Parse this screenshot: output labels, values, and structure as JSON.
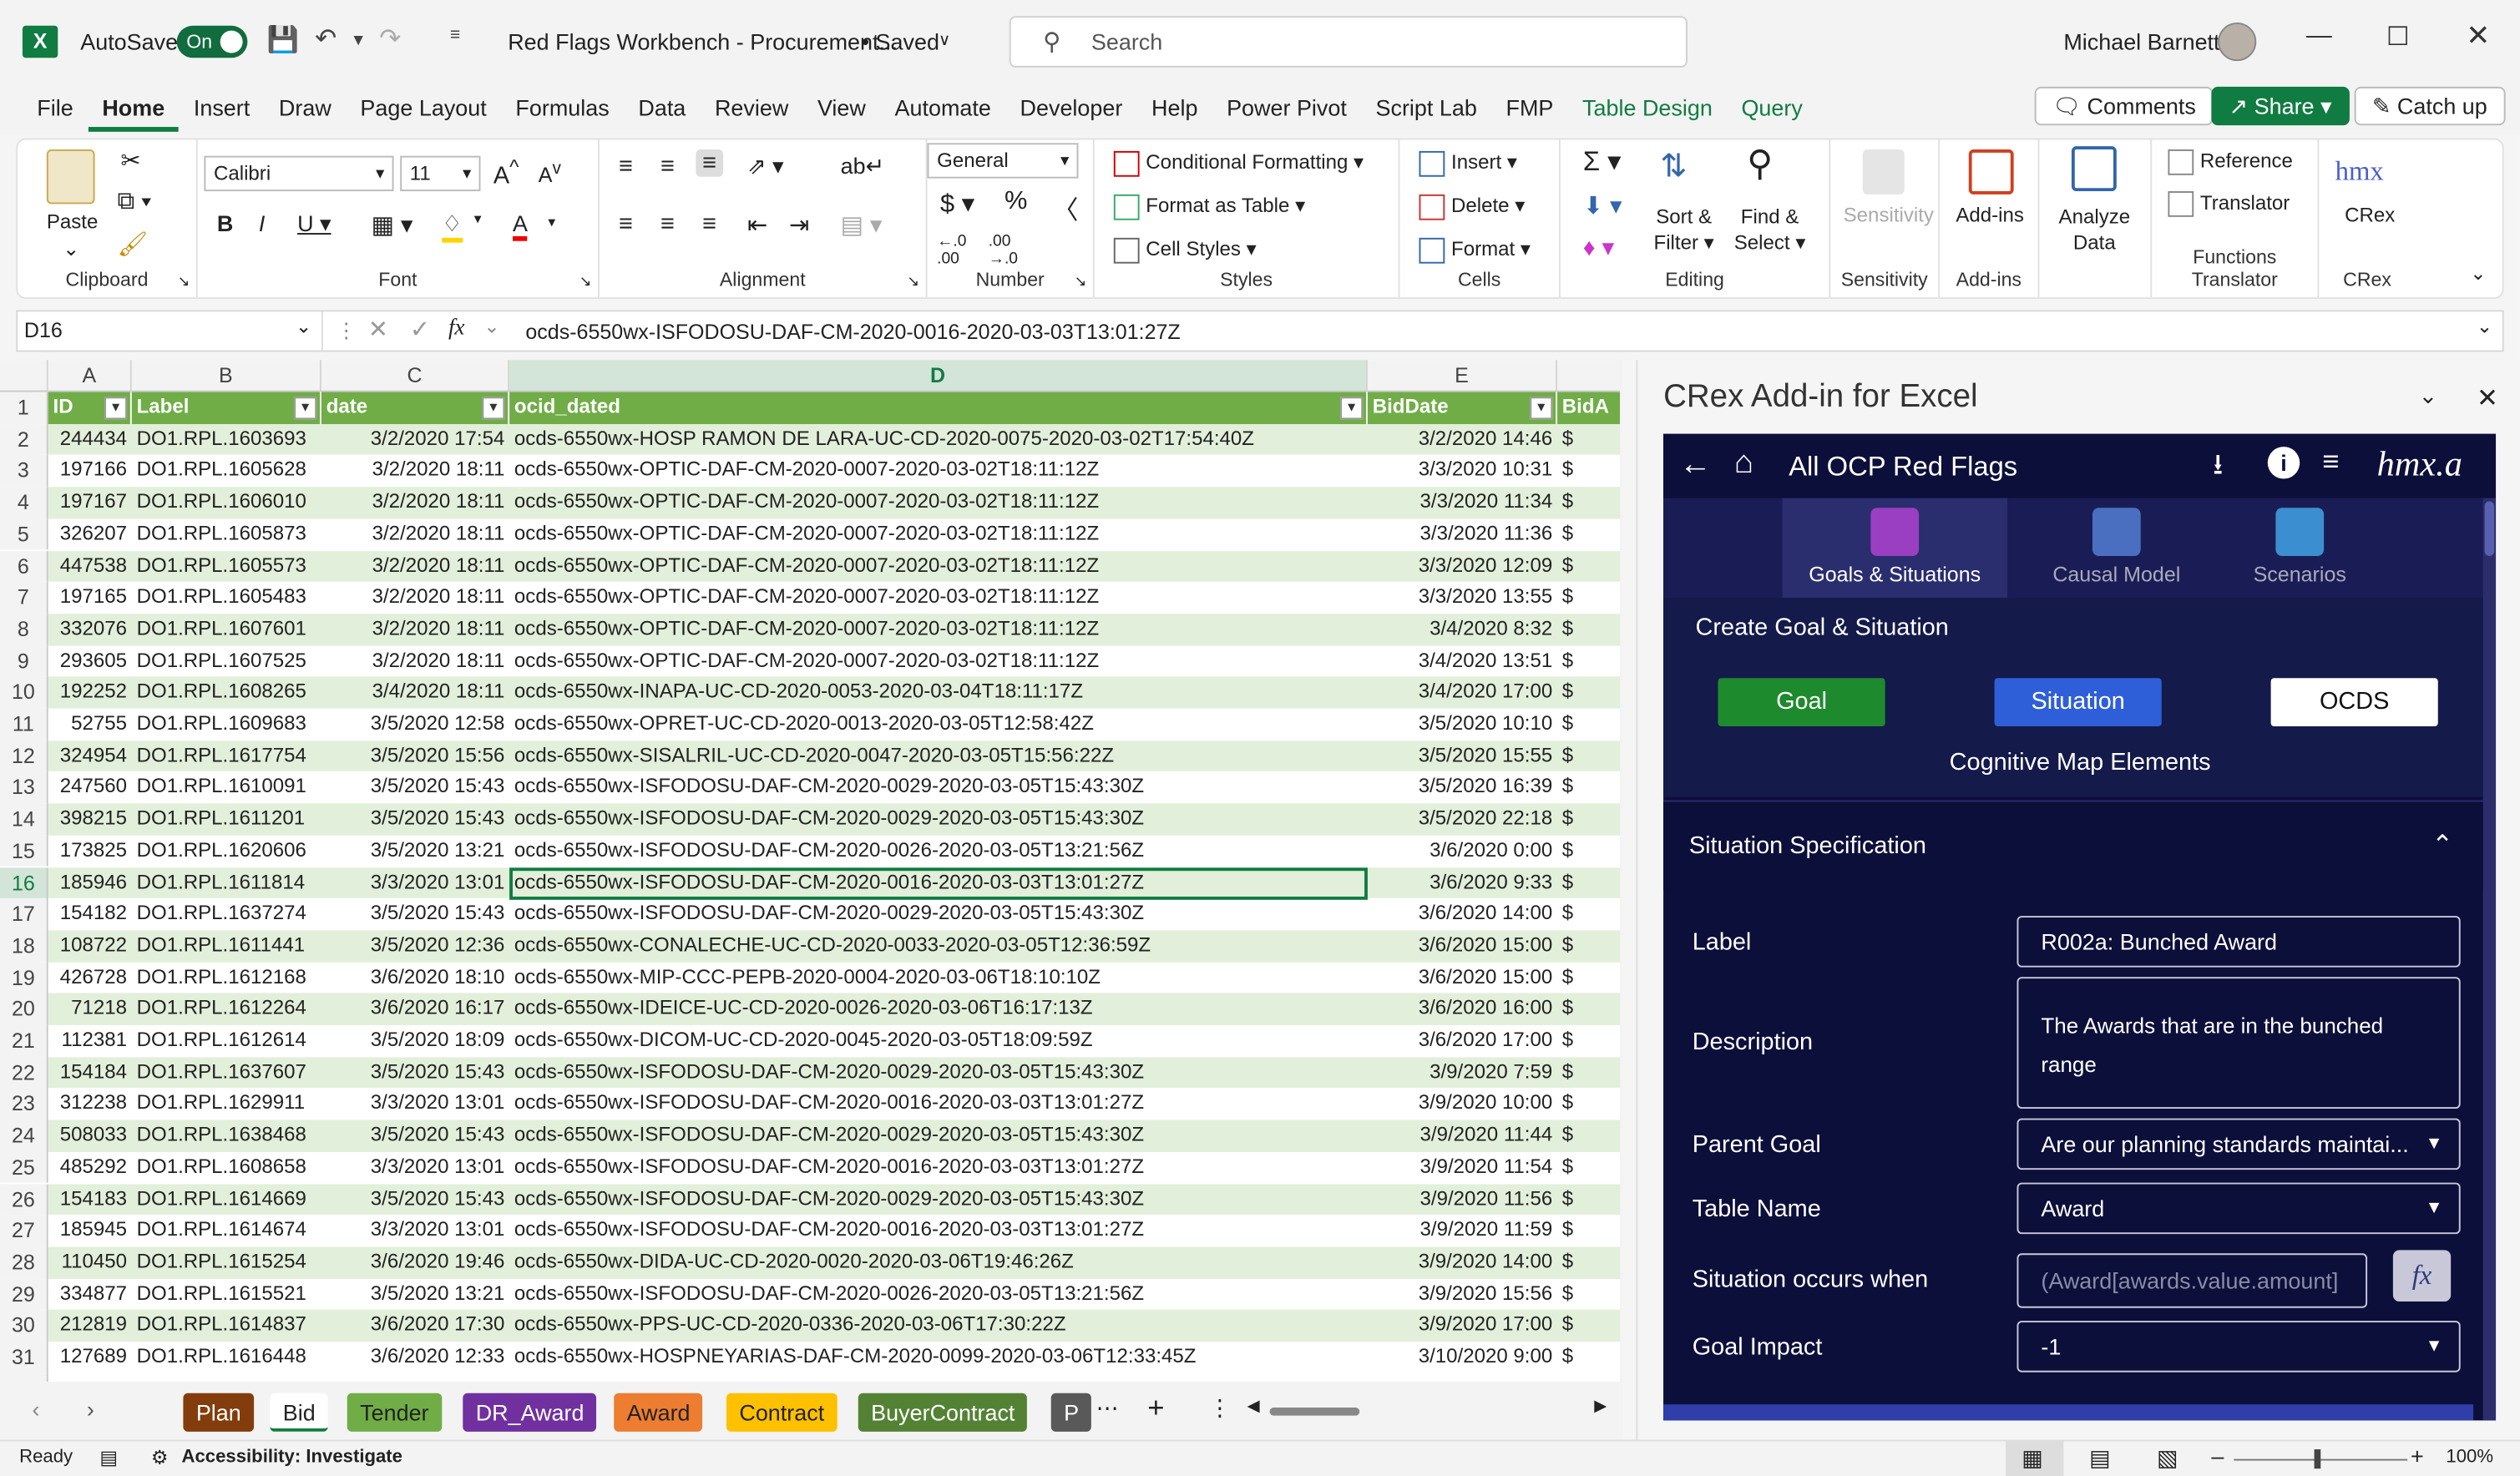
{
  "window": {
    "autosave": "AutoSave",
    "toggle": "On",
    "title": "Red Flags Workbench - Procurement...",
    "saved": "• Saved",
    "search": "Search",
    "user": "Michael Barnett"
  },
  "menu": [
    "File",
    "Home",
    "Insert",
    "Draw",
    "Page Layout",
    "Formulas",
    "Data",
    "Review",
    "View",
    "Automate",
    "Developer",
    "Help",
    "Power Pivot",
    "Script Lab",
    "FMP",
    "Table Design",
    "Query"
  ],
  "top_buttons": {
    "comments": "Comments",
    "share": "Share",
    "catchup": "Catch up"
  },
  "ribbon": {
    "clipboard": {
      "label": "Clipboard",
      "paste": "Paste"
    },
    "font": {
      "label": "Font",
      "name": "Calibri",
      "size": "11"
    },
    "alignment": {
      "label": "Alignment"
    },
    "number": {
      "label": "Number",
      "format": "General"
    },
    "styles": {
      "label": "Styles",
      "cond": "Conditional Formatting",
      "table": "Format as Table",
      "cell": "Cell Styles"
    },
    "cells": {
      "label": "Cells",
      "insert": "Insert",
      "delete": "Delete",
      "format": "Format"
    },
    "editing": {
      "label": "Editing",
      "sort1": "Sort &",
      "sort2": "Filter",
      "find1": "Find &",
      "find2": "Select"
    },
    "sensitivity": {
      "label": "Sensitivity",
      "btn": "Sensitivity"
    },
    "addins": {
      "label": "Add-ins",
      "btn": "Add-ins"
    },
    "analyze": {
      "btn1": "Analyze",
      "btn2": "Data"
    },
    "functrans": {
      "label": "Functions Translator",
      "ref": "Reference",
      "trans": "Translator"
    },
    "crex": {
      "label": "CRex",
      "btn": "CRex",
      "logo": "hmx"
    }
  },
  "formula": {
    "namebox": "D16",
    "fx": "fx",
    "content": "ocds-6550wx-ISFODOSU-DAF-CM-2020-0016-2020-03-03T13:01:27Z"
  },
  "columns": [
    "A",
    "B",
    "C",
    "D",
    "E"
  ],
  "headers": [
    "ID",
    "Label",
    "date",
    "ocid_dated",
    "BidDate",
    "BidA"
  ],
  "rows": [
    [
      "244434",
      "DO1.RPL.1603693",
      "3/2/2020 17:54",
      "ocds-6550wx-HOSP RAMON DE LARA-UC-CD-2020-0075-2020-03-02T17:54:40Z",
      "3/2/2020 14:46"
    ],
    [
      "197166",
      "DO1.RPL.1605628",
      "3/2/2020 18:11",
      "ocds-6550wx-OPTIC-DAF-CM-2020-0007-2020-03-02T18:11:12Z",
      "3/3/2020 10:31"
    ],
    [
      "197167",
      "DO1.RPL.1606010",
      "3/2/2020 18:11",
      "ocds-6550wx-OPTIC-DAF-CM-2020-0007-2020-03-02T18:11:12Z",
      "3/3/2020 11:34"
    ],
    [
      "326207",
      "DO1.RPL.1605873",
      "3/2/2020 18:11",
      "ocds-6550wx-OPTIC-DAF-CM-2020-0007-2020-03-02T18:11:12Z",
      "3/3/2020 11:36"
    ],
    [
      "447538",
      "DO1.RPL.1605573",
      "3/2/2020 18:11",
      "ocds-6550wx-OPTIC-DAF-CM-2020-0007-2020-03-02T18:11:12Z",
      "3/3/2020 12:09"
    ],
    [
      "197165",
      "DO1.RPL.1605483",
      "3/2/2020 18:11",
      "ocds-6550wx-OPTIC-DAF-CM-2020-0007-2020-03-02T18:11:12Z",
      "3/3/2020 13:55"
    ],
    [
      "332076",
      "DO1.RPL.1607601",
      "3/2/2020 18:11",
      "ocds-6550wx-OPTIC-DAF-CM-2020-0007-2020-03-02T18:11:12Z",
      "3/4/2020 8:32"
    ],
    [
      "293605",
      "DO1.RPL.1607525",
      "3/2/2020 18:11",
      "ocds-6550wx-OPTIC-DAF-CM-2020-0007-2020-03-02T18:11:12Z",
      "3/4/2020 13:51"
    ],
    [
      "192252",
      "DO1.RPL.1608265",
      "3/4/2020 18:11",
      "ocds-6550wx-INAPA-UC-CD-2020-0053-2020-03-04T18:11:17Z",
      "3/4/2020 17:00"
    ],
    [
      "52755",
      "DO1.RPL.1609683",
      "3/5/2020 12:58",
      "ocds-6550wx-OPRET-UC-CD-2020-0013-2020-03-05T12:58:42Z",
      "3/5/2020 10:10"
    ],
    [
      "324954",
      "DO1.RPL.1617754",
      "3/5/2020 15:56",
      "ocds-6550wx-SISALRIL-UC-CD-2020-0047-2020-03-05T15:56:22Z",
      "3/5/2020 15:55"
    ],
    [
      "247560",
      "DO1.RPL.1610091",
      "3/5/2020 15:43",
      "ocds-6550wx-ISFODOSU-DAF-CM-2020-0029-2020-03-05T15:43:30Z",
      "3/5/2020 16:39"
    ],
    [
      "398215",
      "DO1.RPL.1611201",
      "3/5/2020 15:43",
      "ocds-6550wx-ISFODOSU-DAF-CM-2020-0029-2020-03-05T15:43:30Z",
      "3/5/2020 22:18"
    ],
    [
      "173825",
      "DO1.RPL.1620606",
      "3/5/2020 13:21",
      "ocds-6550wx-ISFODOSU-DAF-CM-2020-0026-2020-03-05T13:21:56Z",
      "3/6/2020 0:00"
    ],
    [
      "185946",
      "DO1.RPL.1611814",
      "3/3/2020 13:01",
      "ocds-6550wx-ISFODOSU-DAF-CM-2020-0016-2020-03-03T13:01:27Z",
      "3/6/2020 9:33"
    ],
    [
      "154182",
      "DO1.RPL.1637274",
      "3/5/2020 15:43",
      "ocds-6550wx-ISFODOSU-DAF-CM-2020-0029-2020-03-05T15:43:30Z",
      "3/6/2020 14:00"
    ],
    [
      "108722",
      "DO1.RPL.1611441",
      "3/5/2020 12:36",
      "ocds-6550wx-CONALECHE-UC-CD-2020-0033-2020-03-05T12:36:59Z",
      "3/6/2020 15:00"
    ],
    [
      "426728",
      "DO1.RPL.1612168",
      "3/6/2020 18:10",
      "ocds-6550wx-MIP-CCC-PEPB-2020-0004-2020-03-06T18:10:10Z",
      "3/6/2020 15:00"
    ],
    [
      "71218",
      "DO1.RPL.1612264",
      "3/6/2020 16:17",
      "ocds-6550wx-IDEICE-UC-CD-2020-0026-2020-03-06T16:17:13Z",
      "3/6/2020 16:00"
    ],
    [
      "112381",
      "DO1.RPL.1612614",
      "3/5/2020 18:09",
      "ocds-6550wx-DICOM-UC-CD-2020-0045-2020-03-05T18:09:59Z",
      "3/6/2020 17:00"
    ],
    [
      "154184",
      "DO1.RPL.1637607",
      "3/5/2020 15:43",
      "ocds-6550wx-ISFODOSU-DAF-CM-2020-0029-2020-03-05T15:43:30Z",
      "3/9/2020 7:59"
    ],
    [
      "312238",
      "DO1.RPL.1629911",
      "3/3/2020 13:01",
      "ocds-6550wx-ISFODOSU-DAF-CM-2020-0016-2020-03-03T13:01:27Z",
      "3/9/2020 10:00"
    ],
    [
      "508033",
      "DO1.RPL.1638468",
      "3/5/2020 15:43",
      "ocds-6550wx-ISFODOSU-DAF-CM-2020-0029-2020-03-05T15:43:30Z",
      "3/9/2020 11:44"
    ],
    [
      "485292",
      "DO1.RPL.1608658",
      "3/3/2020 13:01",
      "ocds-6550wx-ISFODOSU-DAF-CM-2020-0016-2020-03-03T13:01:27Z",
      "3/9/2020 11:54"
    ],
    [
      "154183",
      "DO1.RPL.1614669",
      "3/5/2020 15:43",
      "ocds-6550wx-ISFODOSU-DAF-CM-2020-0029-2020-03-05T15:43:30Z",
      "3/9/2020 11:56"
    ],
    [
      "185945",
      "DO1.RPL.1614674",
      "3/3/2020 13:01",
      "ocds-6550wx-ISFODOSU-DAF-CM-2020-0016-2020-03-03T13:01:27Z",
      "3/9/2020 11:59"
    ],
    [
      "110450",
      "DO1.RPL.1615254",
      "3/6/2020 19:46",
      "ocds-6550wx-DIDA-UC-CD-2020-0020-2020-03-06T19:46:26Z",
      "3/9/2020 14:00"
    ],
    [
      "334877",
      "DO1.RPL.1615521",
      "3/5/2020 13:21",
      "ocds-6550wx-ISFODOSU-DAF-CM-2020-0026-2020-03-05T13:21:56Z",
      "3/9/2020 15:56"
    ],
    [
      "212819",
      "DO1.RPL.1614837",
      "3/6/2020 17:30",
      "ocds-6550wx-PPS-UC-CD-2020-0336-2020-03-06T17:30:22Z",
      "3/9/2020 17:00"
    ],
    [
      "127689",
      "DO1.RPL.1616448",
      "3/6/2020 12:33",
      "ocds-6550wx-HOSPNEYARIAS-DAF-CM-2020-0099-2020-03-06T12:33:45Z",
      "3/10/2020 9:00"
    ]
  ],
  "dollar": "$",
  "sheets": [
    {
      "name": "Plan",
      "color": "#833c0b",
      "text": "#fff"
    },
    {
      "name": "Bid",
      "color": "#ffffff",
      "text": "#222"
    },
    {
      "name": "Tender",
      "color": "#70ad47",
      "text": "#222"
    },
    {
      "name": "DR_Award",
      "color": "#7030a0",
      "text": "#fff"
    },
    {
      "name": "Award",
      "color": "#ed7d31",
      "text": "#222"
    },
    {
      "name": "Contract",
      "color": "#ffc000",
      "text": "#222"
    },
    {
      "name": "BuyerContract",
      "color": "#548235",
      "text": "#fff"
    },
    {
      "name": "P",
      "color": "#595959",
      "text": "#fff"
    }
  ],
  "status": {
    "ready": "Ready",
    "access": "Accessibility: Investigate",
    "zoom": "100%"
  },
  "pane": {
    "title": "CRex Add-in for Excel",
    "header": "All OCP Red Flags",
    "logo": "hmx.a",
    "tabs": [
      "Goals & Situations",
      "Causal Model",
      "Scenarios"
    ],
    "create": "Create Goal & Situation",
    "btn_goal": "Goal",
    "btn_situation": "Situation",
    "btn_ocds": "OCDS",
    "cog": "Cognitive Map Elements",
    "spec": "Situation Specification",
    "fields": {
      "label": "Label",
      "label_val": "R002a: Bunched Award",
      "desc": "Description",
      "desc_val": "The Awards that are in the bunched range",
      "parent": "Parent Goal",
      "parent_val": "Are our planning standards maintai...",
      "table": "Table Name",
      "table_val": "Award",
      "occurs": "Situation occurs when",
      "occurs_ph": "(Award[awards.value.amount]",
      "impact": "Goal Impact",
      "impact_val": "-1",
      "fx": "fx"
    }
  },
  "colors": {
    "excel_green": "#107c41",
    "table_header": "#70ad47",
    "band": "#e2efda",
    "pane_bg": "#0c0f3a",
    "goal": "#1e8a2e",
    "situation": "#2f5fd8"
  }
}
